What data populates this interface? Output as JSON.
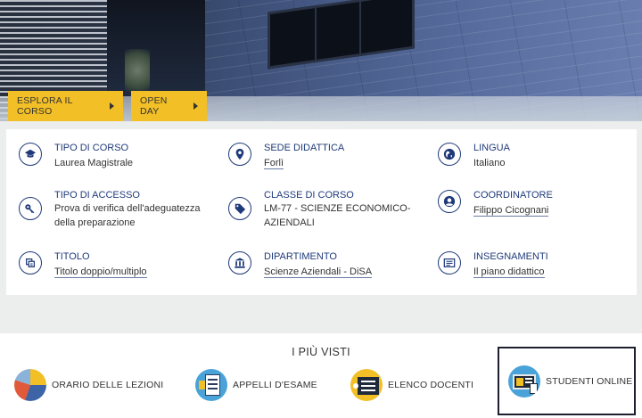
{
  "hero": {
    "buttons": [
      {
        "label": "ESPLORA IL CORSO"
      },
      {
        "label": "OPEN DAY"
      }
    ]
  },
  "info": {
    "items": [
      {
        "label": "TIPO DI CORSO",
        "value": [
          "Laurea Magistrale"
        ],
        "icon": "graduation-cap-icon",
        "link": false
      },
      {
        "label": "SEDE DIDATTICA",
        "value": [
          "Forlì"
        ],
        "icon": "map-pin-icon",
        "link": true
      },
      {
        "label": "LINGUA",
        "value": [
          "Italiano"
        ],
        "icon": "globe-icon",
        "link": false
      },
      {
        "label": "TIPO DI ACCESSO",
        "value": [
          "Prova di verifica dell'adeguatezza",
          "della preparazione"
        ],
        "icon": "key-icon",
        "link": false
      },
      {
        "label": "CLASSE DI CORSO",
        "value": [
          "LM-77 - SCIENZE ECONOMICO-",
          "AZIENDALI"
        ],
        "icon": "tag-icon",
        "link": false
      },
      {
        "label": "COORDINATORE",
        "value": [
          "Filippo Cicognani"
        ],
        "icon": "user-icon",
        "link": true
      },
      {
        "label": "TITOLO",
        "value": [
          "Titolo doppio/multiplo"
        ],
        "icon": "diploma-icon",
        "link": true
      },
      {
        "label": "DIPARTIMENTO",
        "value": [
          "Scienze Aziendali - DiSA"
        ],
        "icon": "institution-icon",
        "link": true
      },
      {
        "label": "INSEGNAMENTI",
        "value": [
          "Il piano didattico"
        ],
        "icon": "list-card-icon",
        "link": true
      }
    ]
  },
  "visti": {
    "title": "I PIÙ VISTI",
    "items": [
      {
        "label": "ORARIO DELLE LEZIONI",
        "icon": "pie-chart-icon"
      },
      {
        "label": "APPELLI D'ESAME",
        "icon": "exam-form-icon"
      },
      {
        "label": "ELENCO DOCENTI",
        "icon": "teachers-list-icon"
      },
      {
        "label": "STUDENTI ONLINE",
        "icon": "students-online-icon"
      }
    ]
  },
  "colors": {
    "accent_yellow": "#f2bf26",
    "primary_blue": "#1f3a7a"
  }
}
